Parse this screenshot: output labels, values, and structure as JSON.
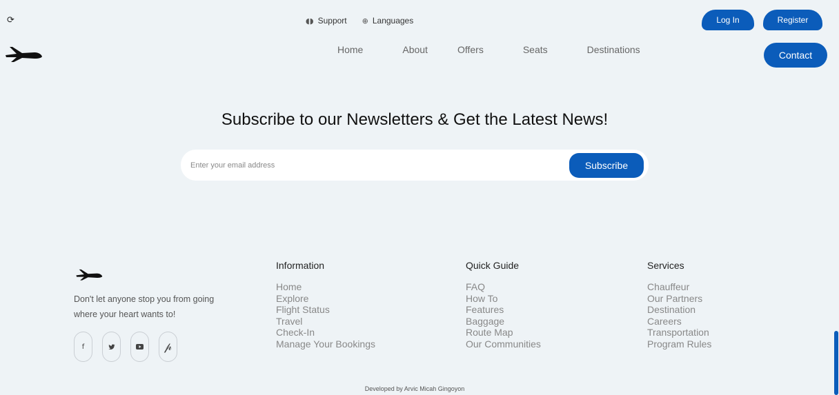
{
  "topbar": {
    "corner_icon": "refresh-cookie-icon",
    "support_label": "Support",
    "support_icon": "headset-icon",
    "languages_label": "Languages",
    "languages_icon": "globe-icon",
    "login_label": "Log In",
    "register_label": "Register"
  },
  "nav": {
    "items": [
      {
        "label": "Home"
      },
      {
        "label": "About"
      },
      {
        "label": "Offers"
      },
      {
        "label": "Seats"
      },
      {
        "label": "Destinations"
      }
    ],
    "contact_label": "Contact"
  },
  "subscribe": {
    "headline": "Subscribe to our Newsletters & Get the Latest News!",
    "email_placeholder": "Enter your email address",
    "button_label": "Subscribe"
  },
  "footer": {
    "tagline": "Don't let anyone stop you from going where your heart wants to!",
    "socials": [
      {
        "icon": "facebook-icon",
        "glyph": "f"
      },
      {
        "icon": "twitter-icon",
        "glyph": "🐦"
      },
      {
        "icon": "youtube-icon",
        "glyph": "▶"
      },
      {
        "icon": "pinterest-icon",
        "glyph": "𝒫"
      }
    ],
    "columns": [
      {
        "title": "Information",
        "links": [
          "Home",
          "Explore",
          "Flight Status",
          "Travel",
          "Check-In",
          "Manage Your Bookings"
        ]
      },
      {
        "title": "Quick Guide",
        "links": [
          "FAQ",
          "How To",
          "Features",
          "Baggage",
          "Route Map",
          "Our Communities"
        ]
      },
      {
        "title": "Services",
        "links": [
          "Chauffeur",
          "Our Partners",
          "Destination",
          "Careers",
          "Transportation",
          "Program Rules"
        ]
      }
    ],
    "credit": "Developed by Arvic Micah Gingoyon"
  },
  "colors": {
    "accent": "#0b5cba",
    "background": "#eef3f6"
  }
}
